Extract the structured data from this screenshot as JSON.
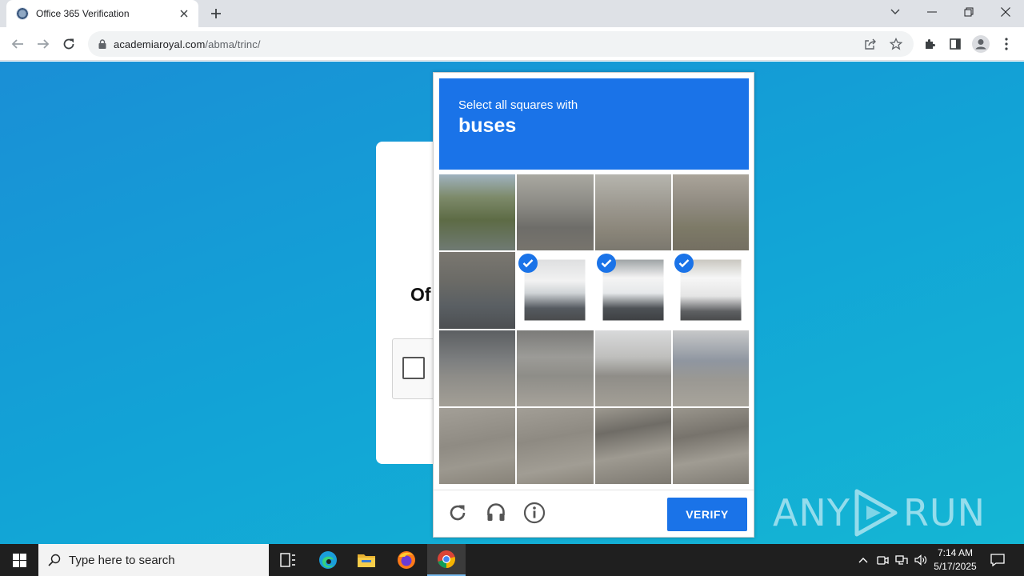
{
  "browser": {
    "tab_title": "Office 365 Verification",
    "url_domain": "academiaroyal.com",
    "url_path": "/abma/trinc/"
  },
  "page": {
    "card_heading": "Of"
  },
  "captcha": {
    "instruction": "Select all squares with",
    "target": "buses",
    "selected_tiles": [
      5,
      6,
      7
    ],
    "verify_label": "VERIFY"
  },
  "watermark": {
    "text_left": "ANY",
    "text_right": "RUN"
  },
  "taskbar": {
    "search_placeholder": "Type here to search",
    "time": "7:14 AM",
    "date": "5/17/2025"
  },
  "colors": {
    "accent": "#1a73e8",
    "page_bg_start": "#1a8fd6",
    "page_bg_end": "#14b6d4",
    "taskbar": "#1f1f1f"
  }
}
